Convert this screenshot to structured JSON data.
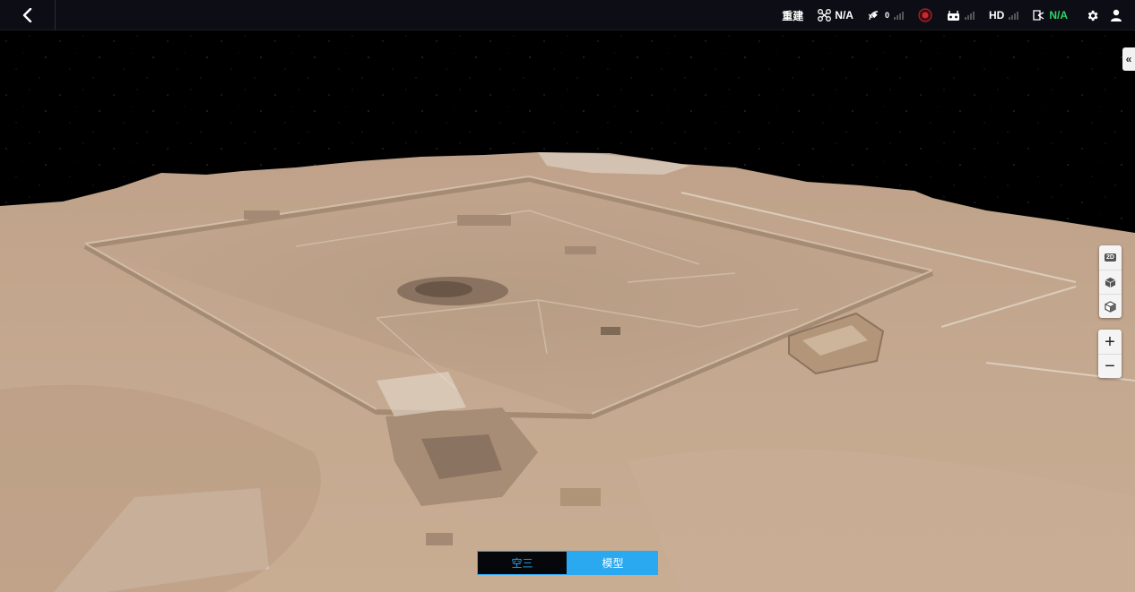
{
  "topbar": {
    "rebuild_label": "重建",
    "drone_status": "N/A",
    "gps_count": "0",
    "link_label": "HD",
    "battery_status": "N/A"
  },
  "view_tools": {
    "mode_2d": "2D"
  },
  "zoom": {
    "in_label": "+",
    "out_label": "−"
  },
  "mode_toggle": {
    "option1": "空三",
    "option2": "模型",
    "selected": "模型"
  },
  "colors": {
    "accent": "#2aa8f0",
    "status_green": "#2fd36a",
    "topbar_bg": "#0d0e15",
    "sand": "#c8a98a"
  },
  "icons": {
    "back": "chevron-left-icon",
    "drone": "drone-icon",
    "satellite": "satellite-icon",
    "record": "record-icon",
    "remote": "remote-controller-icon",
    "battery": "aircraft-battery-icon",
    "settings": "gear-icon",
    "user": "user-icon",
    "collapse": "double-chevron-left-icon",
    "cube_solid": "cube-solid-icon",
    "cube_outline": "cube-outline-icon"
  }
}
